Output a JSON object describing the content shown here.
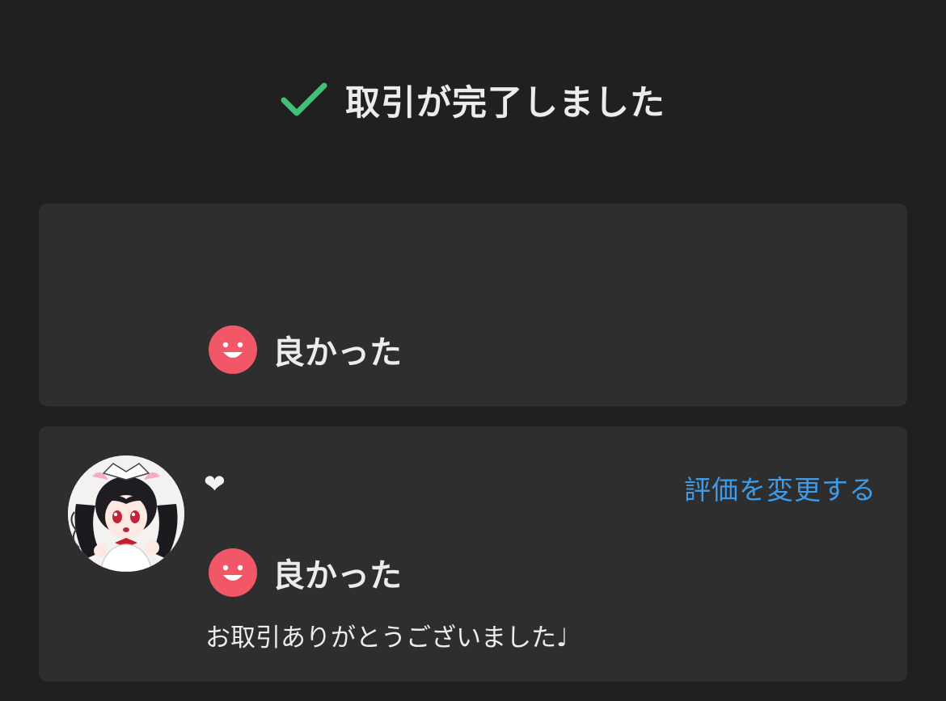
{
  "header": {
    "title": "取引が完了しました",
    "icon": "check-icon",
    "icon_color": "#3fc275"
  },
  "summary": {
    "rating_icon": "smile-icon",
    "rating_color": "#f25767",
    "rating_label": "良かった"
  },
  "review": {
    "avatar": "avatar-image",
    "username": "❤",
    "change_label": "評価を変更する",
    "rating_icon": "smile-icon",
    "rating_label": "良かった",
    "comment": "お取引ありがとうございました♩"
  },
  "colors": {
    "background": "#202020",
    "card": "#2e2e2e",
    "link": "#3d9be9",
    "text": "#ececec"
  }
}
